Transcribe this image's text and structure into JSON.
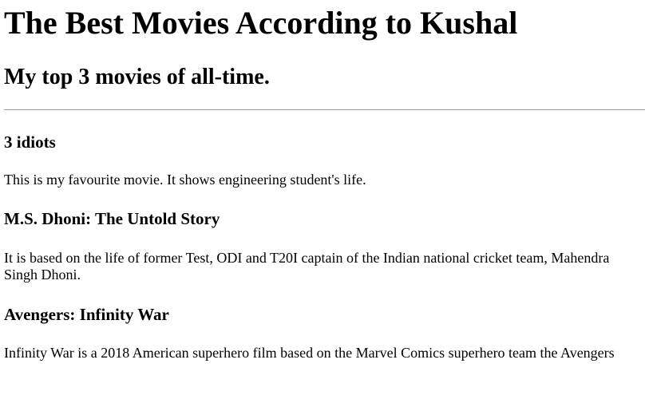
{
  "header": {
    "title": "The Best Movies According to Kushal",
    "subtitle": "My top 3 movies of all-time."
  },
  "movies": [
    {
      "title": "3 idiots",
      "description": "This is my favourite movie. It shows engineering student's life."
    },
    {
      "title": "M.S. Dhoni: The Untold Story",
      "description": "It is based on the life of former Test, ODI and T20I captain of the Indian national cricket team, Mahendra Singh Dhoni."
    },
    {
      "title": "Avengers: Infinity War",
      "description": "Infinity War is a 2018 American superhero film based on the Marvel Comics superhero team the Avengers"
    }
  ]
}
